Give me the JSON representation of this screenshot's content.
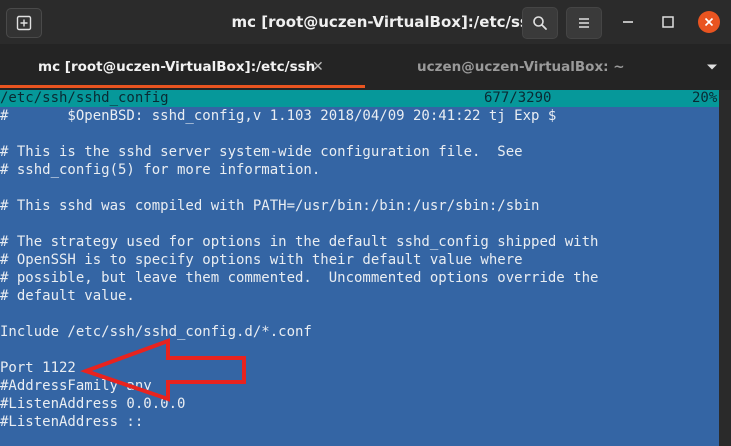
{
  "window": {
    "title": "mc [root@uczen-VirtualBox]:/etc/ssh"
  },
  "tabs": [
    {
      "label": "mc [root@uczen-VirtualBox]:/etc/ssh",
      "active": true
    },
    {
      "label": "uczen@uczen-VirtualBox: ~",
      "active": false
    }
  ],
  "editor": {
    "filepath": "/etc/ssh/sshd_config",
    "position": "677/3290",
    "percent": "20%",
    "lines": [
      "#       $OpenBSD: sshd_config,v 1.103 2018/04/09 20:41:22 tj Exp $",
      "",
      "# This is the sshd server system-wide configuration file.  See",
      "# sshd_config(5) for more information.",
      "",
      "# This sshd was compiled with PATH=/usr/bin:/bin:/usr/sbin:/sbin",
      "",
      "# The strategy used for options in the default sshd_config shipped with",
      "# OpenSSH is to specify options with their default value where",
      "# possible, but leave them commented.  Uncommented options override the",
      "# default value.",
      "",
      "Include /etc/ssh/sshd_config.d/*.conf",
      "",
      "Port 1122",
      "#AddressFamily any",
      "#ListenAddress 0.0.0.0",
      "#ListenAddress ::"
    ]
  },
  "annotation": {
    "color": "#e8231f",
    "icon": "red-arrow-pointing-left"
  },
  "icons": {
    "new_tab": "new-tab-icon",
    "search": "search-icon",
    "menu": "hamburger-menu-icon",
    "minimize": "minimize-icon",
    "maximize": "maximize-icon",
    "close": "close-icon",
    "tab_close": "tab-close-icon",
    "tab_dropdown": "chevron-down-icon"
  },
  "colors": {
    "terminal_bg": "#3465a4",
    "status_bar_bg": "#06989a",
    "accent": "#e95420",
    "text": "#e9edf2"
  }
}
